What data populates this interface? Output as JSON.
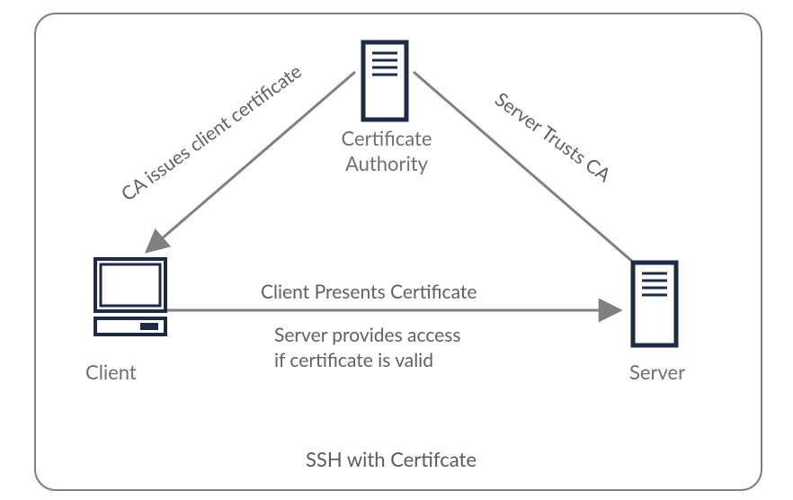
{
  "title": "SSH with Certifcate",
  "nodes": {
    "ca": {
      "label_line1": "Certificate",
      "label_line2": "Authority"
    },
    "client": {
      "label": "Client"
    },
    "server": {
      "label": "Server"
    }
  },
  "edges": {
    "ca_to_client": {
      "label": "CA issues client certificate"
    },
    "ca_to_server": {
      "label": "Server Trusts CA"
    },
    "client_to_server": {
      "label_top": "Client Presents Certificate",
      "label_mid": "Server provides access",
      "label_bot": "if certificate is valid"
    }
  }
}
